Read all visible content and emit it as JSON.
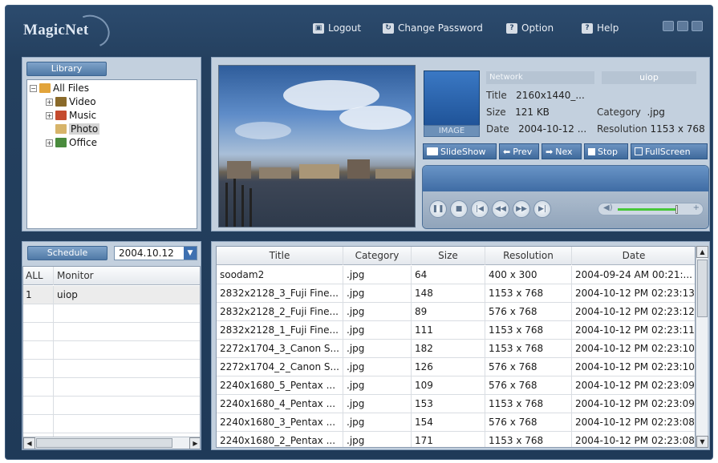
{
  "app": {
    "logo": "MagicNet",
    "menu": [
      {
        "label": "Logout",
        "icon": "lock-icon"
      },
      {
        "label": "Change Password",
        "icon": "refresh-icon"
      },
      {
        "label": "Option",
        "icon": "question-icon"
      },
      {
        "label": "Help",
        "icon": "question-icon"
      }
    ]
  },
  "library": {
    "tab": "Library",
    "tree": [
      {
        "label": "All Files",
        "expander": "⊟"
      },
      {
        "label": "Video",
        "expander": "⊞"
      },
      {
        "label": "Music",
        "expander": "⊞"
      },
      {
        "label": "Photo",
        "expander": ""
      },
      {
        "label": "Office",
        "expander": "⊞"
      }
    ]
  },
  "preview": {
    "thumb_label": "IMAGE",
    "network_label": "Network",
    "user": "uiop",
    "title_label": "Title",
    "title_value": "2160x1440_...",
    "size_label": "Size",
    "size_value": "121 KB",
    "date_label": "Date",
    "date_value": "2004-10-12 ...",
    "category_label": "Category",
    "category_value": ".jpg",
    "resolution_label": "Resolution",
    "resolution_value": "1153 x 768",
    "buttons": [
      "SlideShow",
      "Prev",
      "Nex",
      "Stop",
      "FullScreen"
    ],
    "volume_level": 0.72
  },
  "schedule": {
    "tab": "Schedule",
    "date": "2004.10.12",
    "columns": [
      "ALL",
      "Monitor"
    ],
    "rows": [
      {
        "no": "1",
        "monitor": "uiop"
      }
    ]
  },
  "files": {
    "columns": [
      "Title",
      "Category",
      "Size",
      "Resolution",
      "Date"
    ],
    "rows": [
      {
        "title": "soodam2",
        "category": ".jpg",
        "size": "64",
        "resolution": "400 x 300",
        "date": "2004-09-24 AM 00:21:..."
      },
      {
        "title": "2832x2128_3_Fuji Fine...",
        "category": ".jpg",
        "size": "148",
        "resolution": "1153 x 768",
        "date": "2004-10-12 PM 02:23:13"
      },
      {
        "title": "2832x2128_2_Fuji Fine...",
        "category": ".jpg",
        "size": "89",
        "resolution": "576 x 768",
        "date": "2004-10-12 PM 02:23:12"
      },
      {
        "title": "2832x2128_1_Fuji Fine...",
        "category": ".jpg",
        "size": "111",
        "resolution": "1153 x 768",
        "date": "2004-10-12 PM 02:23:11"
      },
      {
        "title": "2272x1704_3_Canon S...",
        "category": ".jpg",
        "size": "182",
        "resolution": "1153 x 768",
        "date": "2004-10-12 PM 02:23:10"
      },
      {
        "title": "2272x1704_2_Canon S...",
        "category": ".jpg",
        "size": "126",
        "resolution": "576 x 768",
        "date": "2004-10-12 PM 02:23:10"
      },
      {
        "title": "2240x1680_5_Pentax ...",
        "category": ".jpg",
        "size": "109",
        "resolution": "576 x 768",
        "date": "2004-10-12 PM 02:23:09"
      },
      {
        "title": "2240x1680_4_Pentax ...",
        "category": ".jpg",
        "size": "153",
        "resolution": "1153 x 768",
        "date": "2004-10-12 PM 02:23:09"
      },
      {
        "title": "2240x1680_3_Pentax ...",
        "category": ".jpg",
        "size": "154",
        "resolution": "576 x 768",
        "date": "2004-10-12 PM 02:23:08"
      },
      {
        "title": "2240x1680_2_Pentax ...",
        "category": ".jpg",
        "size": "171",
        "resolution": "1153 x 768",
        "date": "2004-10-12 PM 02:23:08"
      }
    ]
  }
}
